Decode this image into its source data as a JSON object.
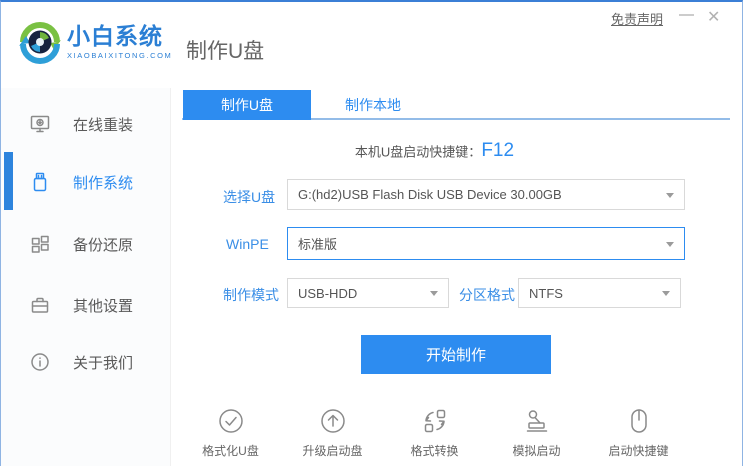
{
  "window_controls": {
    "disclaimer": "免责声明",
    "minimize": "—",
    "close": "✕"
  },
  "header": {
    "brand": "小白系统",
    "brand_sub": "XIAOBAIXITONG.COM",
    "page_title": "制作U盘"
  },
  "sidebar": {
    "items": [
      {
        "label": "在线重装",
        "icon": "monitor-reinstall-icon",
        "active": false
      },
      {
        "label": "制作系统",
        "icon": "usb-drive-icon",
        "active": true
      },
      {
        "label": "备份还原",
        "icon": "backup-grid-icon",
        "active": false
      },
      {
        "label": "其他设置",
        "icon": "briefcase-icon",
        "active": false
      },
      {
        "label": "关于我们",
        "icon": "info-circle-icon",
        "active": false
      }
    ]
  },
  "tabs": [
    {
      "label": "制作U盘",
      "active": true
    },
    {
      "label": "制作本地",
      "active": false
    }
  ],
  "main": {
    "hotkey_label": "本机U盘启动快捷键：",
    "hotkey_value": "F12",
    "fields": {
      "usb": {
        "label": "选择U盘",
        "value": "G:(hd2)USB Flash Disk USB Device 30.00GB"
      },
      "winpe": {
        "label": "WinPE",
        "value": "标准版"
      },
      "mode": {
        "label": "制作模式",
        "value": "USB-HDD"
      },
      "partition": {
        "label": "分区格式",
        "value": "NTFS"
      }
    },
    "start_button": "开始制作",
    "tools": [
      {
        "label": "格式化U盘",
        "icon": "check-circle-icon"
      },
      {
        "label": "升级启动盘",
        "icon": "upgrade-arrow-circle-icon"
      },
      {
        "label": "格式转换",
        "icon": "format-convert-icon"
      },
      {
        "label": "模拟启动",
        "icon": "stamp-simulate-icon"
      },
      {
        "label": "启动快捷键",
        "icon": "mouse-hotkey-icon"
      }
    ]
  },
  "colors": {
    "primary": "#2d8cf0",
    "active_tab": "#2d8cf0",
    "window_border_top": "#3b7fd6",
    "tab_underline": "#93bce8",
    "label_blue": "#3a8ee6",
    "text_gray": "#666666"
  }
}
